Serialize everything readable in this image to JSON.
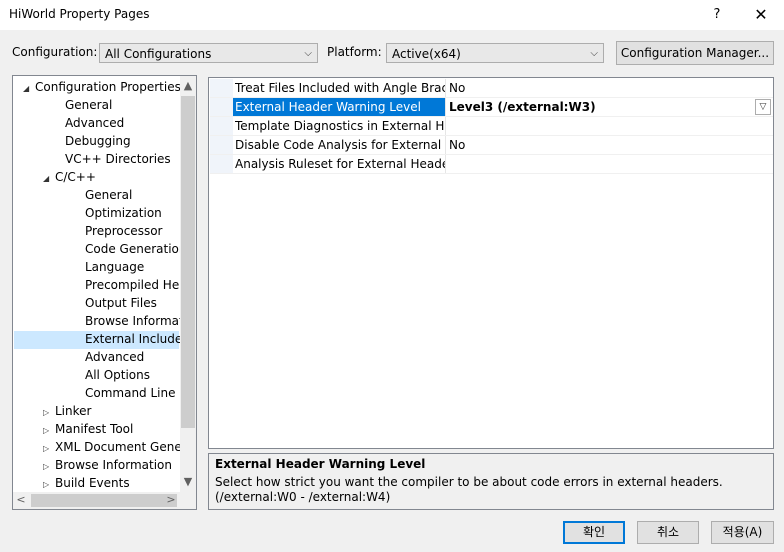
{
  "window": {
    "title": "HiWorld Property Pages",
    "help": "?",
    "close": "✕"
  },
  "config": {
    "configuration_label": "Configuration:",
    "configuration_value": "All Configurations",
    "platform_label": "Platform:",
    "platform_value": "Active(x64)",
    "manager_button": "Configuration Manager..."
  },
  "tree": {
    "items": [
      {
        "label": "Configuration Properties",
        "expander": "◢"
      },
      {
        "label": "General"
      },
      {
        "label": "Advanced"
      },
      {
        "label": "Debugging"
      },
      {
        "label": "VC++ Directories"
      },
      {
        "label": "C/C++",
        "expander": "◢"
      },
      {
        "label": "General"
      },
      {
        "label": "Optimization"
      },
      {
        "label": "Preprocessor"
      },
      {
        "label": "Code Generation"
      },
      {
        "label": "Language"
      },
      {
        "label": "Precompiled Heade"
      },
      {
        "label": "Output Files"
      },
      {
        "label": "Browse Informatior"
      },
      {
        "label": "External Includes"
      },
      {
        "label": "Advanced"
      },
      {
        "label": "All Options"
      },
      {
        "label": "Command Line"
      },
      {
        "label": "Linker",
        "expander": "▷"
      },
      {
        "label": "Manifest Tool",
        "expander": "▷"
      },
      {
        "label": "XML Document Genera",
        "expander": "▷"
      },
      {
        "label": "Browse Information",
        "expander": "▷"
      },
      {
        "label": "Build Events",
        "expander": "▷"
      }
    ],
    "selected": "External Includes"
  },
  "grid": {
    "rows": [
      {
        "name": "Treat Files Included with Angle Brackets",
        "value": "No"
      },
      {
        "name": "External Header Warning Level",
        "value": "Level3 (/external:W3)"
      },
      {
        "name": "Template Diagnostics in External Headers",
        "value": ""
      },
      {
        "name": "Disable Code Analysis for External Headers",
        "value": "No"
      },
      {
        "name": "Analysis Ruleset for External Headers",
        "value": ""
      }
    ],
    "dropdown_arrow": "▽"
  },
  "description": {
    "title": "External Header Warning Level",
    "text": "Select how strict you want the compiler to be about code errors in external headers.      (/external:W0 - /external:W4)"
  },
  "buttons": {
    "ok": "확인",
    "cancel": "취소",
    "apply": "적용(A)"
  },
  "icons": {
    "scroll_up": "▲",
    "scroll_down": "▼",
    "scroll_left": "<",
    "scroll_right": ">",
    "combo_arrow": "⌵"
  }
}
